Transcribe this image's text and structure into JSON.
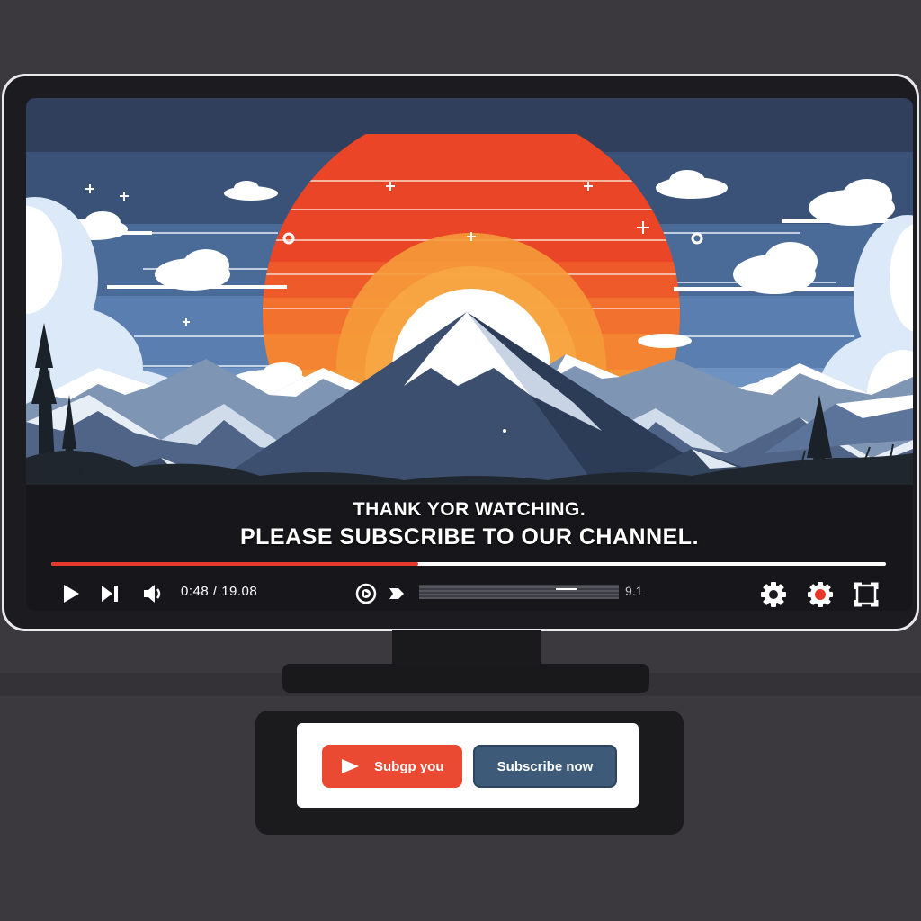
{
  "video": {
    "subtitle_line1": "THANK YOR WATCHING.",
    "subtitle_line2": "PLEASE SUBSCRIBE TO OUR CHANNEL.",
    "progress_fraction": 0.44
  },
  "controls": {
    "time": "0:48 / 19.08",
    "playback_rate": "9.1",
    "volume_fraction": 0.74
  },
  "buttons": {
    "subscribe_label": "Subgp you",
    "secondary_label": "Subscribe now"
  },
  "colors": {
    "accent_red": "#e8382b",
    "sky_blue": "#4e72a4",
    "button_red": "#e94a31",
    "button_blue": "#3d5a78",
    "sun_orange": "#f59434"
  },
  "icons": [
    "play-icon",
    "next-icon",
    "volume-icon",
    "captions-icon",
    "share-icon",
    "settings-icon",
    "record-icon",
    "fullscreen-icon",
    "youtube-play-icon"
  ]
}
